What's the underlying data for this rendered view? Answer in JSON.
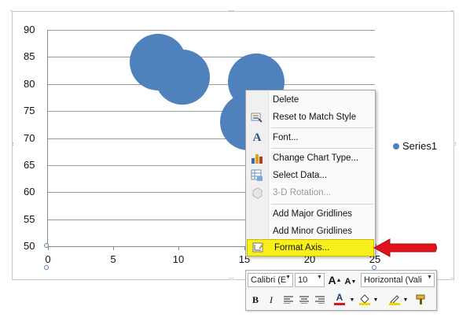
{
  "chart_data": {
    "type": "bubble",
    "ylim": [
      50,
      90
    ],
    "xlim": [
      0,
      25
    ],
    "y_ticks": [
      "90",
      "85",
      "80",
      "75",
      "70",
      "65",
      "60",
      "55",
      "50"
    ],
    "x_ticks": [
      "0",
      "5",
      "10",
      "15",
      "20",
      "25"
    ],
    "series": [
      {
        "name": "Series1",
        "points": [
          {
            "x": 8.4,
            "y": 84,
            "size": 1.0
          },
          {
            "x": 10.3,
            "y": 81.2,
            "size": 0.95
          },
          {
            "x": 15.9,
            "y": 80.4,
            "size": 1.0
          },
          {
            "x": 15.3,
            "y": 73,
            "size": 1.0
          }
        ]
      }
    ],
    "legend_position": "right",
    "grid": true,
    "colors": {
      "series": "#4f81bd",
      "highlight": "#f7f01c",
      "arrow": "#e0121b"
    }
  },
  "context_menu": {
    "items": [
      {
        "label": "Delete",
        "icon": "none",
        "disabled": false
      },
      {
        "label": "Reset to Match Style",
        "icon": "reset-style-icon",
        "disabled": false
      },
      {
        "label": "Font...",
        "icon": "font-icon",
        "disabled": false
      },
      {
        "label": "Change Chart Type...",
        "icon": "chart-type-icon",
        "disabled": false
      },
      {
        "label": "Select Data...",
        "icon": "select-data-icon",
        "disabled": false
      },
      {
        "label": "3-D Rotation...",
        "icon": "rotation-icon",
        "disabled": true
      },
      {
        "label": "Add Major Gridlines",
        "icon": "none",
        "disabled": false
      },
      {
        "label": "Add Minor Gridlines",
        "icon": "none",
        "disabled": false
      },
      {
        "label": "Format Axis...",
        "icon": "format-axis-icon",
        "disabled": false,
        "highlighted": true
      }
    ]
  },
  "mini_toolbar": {
    "font_name": "Calibri (E",
    "font_size": "10",
    "grow_font": "A",
    "shrink_font": "A",
    "alignment": "Horizontal (Vali",
    "bold": "B",
    "italic": "I",
    "font_color_letter": "A"
  }
}
